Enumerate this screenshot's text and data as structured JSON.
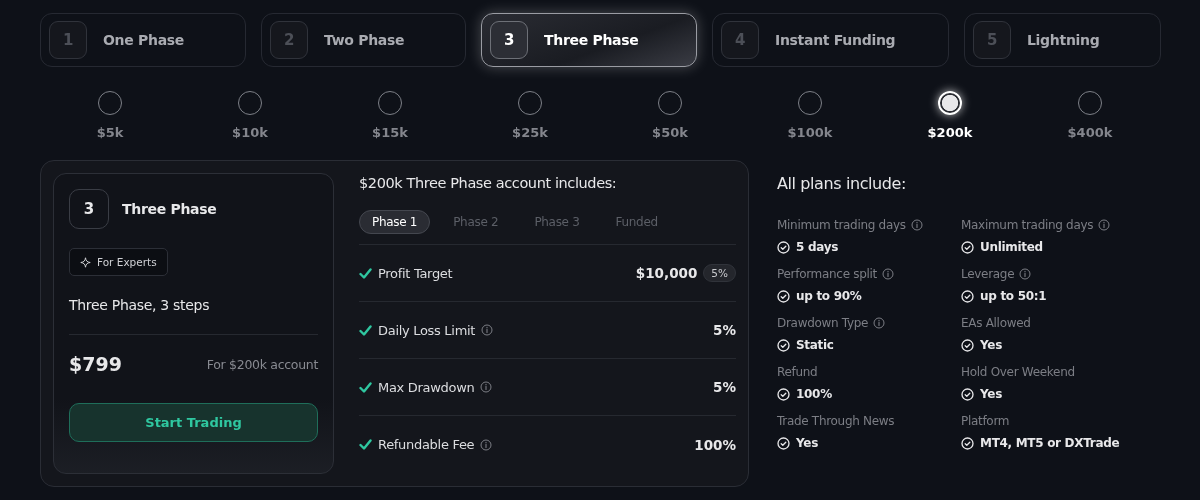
{
  "plan_tabs": [
    {
      "number": "1",
      "label": "One Phase",
      "selected": false
    },
    {
      "number": "2",
      "label": "Two Phase",
      "selected": false
    },
    {
      "number": "3",
      "label": "Three Phase",
      "selected": true
    },
    {
      "number": "4",
      "label": "Instant Funding",
      "selected": false
    },
    {
      "number": "5",
      "label": "Lightning",
      "selected": false
    }
  ],
  "account_sizes": [
    {
      "label": "$5k",
      "selected": false
    },
    {
      "label": "$10k",
      "selected": false
    },
    {
      "label": "$15k",
      "selected": false
    },
    {
      "label": "$25k",
      "selected": false
    },
    {
      "label": "$50k",
      "selected": false
    },
    {
      "label": "$100k",
      "selected": false
    },
    {
      "label": "$200k",
      "selected": true
    },
    {
      "label": "$400k",
      "selected": false
    }
  ],
  "plan_card": {
    "number": "3",
    "title": "Three Phase",
    "badge": "For Experts",
    "subtitle": "Three Phase, 3 steps",
    "price": "$799",
    "price_note": "For $200k account",
    "button": "Start Trading"
  },
  "details": {
    "title": "$200k Three Phase account includes:",
    "phase_tabs": [
      {
        "label": "Phase 1",
        "selected": true
      },
      {
        "label": "Phase 2",
        "selected": false
      },
      {
        "label": "Phase 3",
        "selected": false
      },
      {
        "label": "Funded",
        "selected": false
      }
    ],
    "rows": [
      {
        "label": "Profit Target",
        "info": false,
        "value": "$10,000",
        "tag": "5%"
      },
      {
        "label": "Daily Loss Limit",
        "info": true,
        "value": "5%"
      },
      {
        "label": "Max Drawdown",
        "info": true,
        "value": "5%"
      },
      {
        "label": "Refundable Fee",
        "info": true,
        "value": "100%"
      }
    ]
  },
  "all_plans": {
    "title": "All plans include:",
    "features": [
      {
        "label": "Minimum trading days",
        "info": true,
        "value": "5 days"
      },
      {
        "label": "Maximum trading days",
        "info": true,
        "value": "Unlimited"
      },
      {
        "label": "Performance split",
        "info": true,
        "value": "up to 90%"
      },
      {
        "label": "Leverage",
        "info": true,
        "value": "up to 50:1"
      },
      {
        "label": "Drawdown Type",
        "info": true,
        "value": "Static"
      },
      {
        "label": "EAs Allowed",
        "info": false,
        "value": "Yes"
      },
      {
        "label": "Refund",
        "info": false,
        "value": "100%"
      },
      {
        "label": "Hold Over Weekend",
        "info": false,
        "value": "Yes"
      },
      {
        "label": "Trade Through News",
        "info": false,
        "value": "Yes"
      },
      {
        "label": "Platform",
        "info": false,
        "value": "MT4, MT5 or DXTrade"
      }
    ]
  }
}
